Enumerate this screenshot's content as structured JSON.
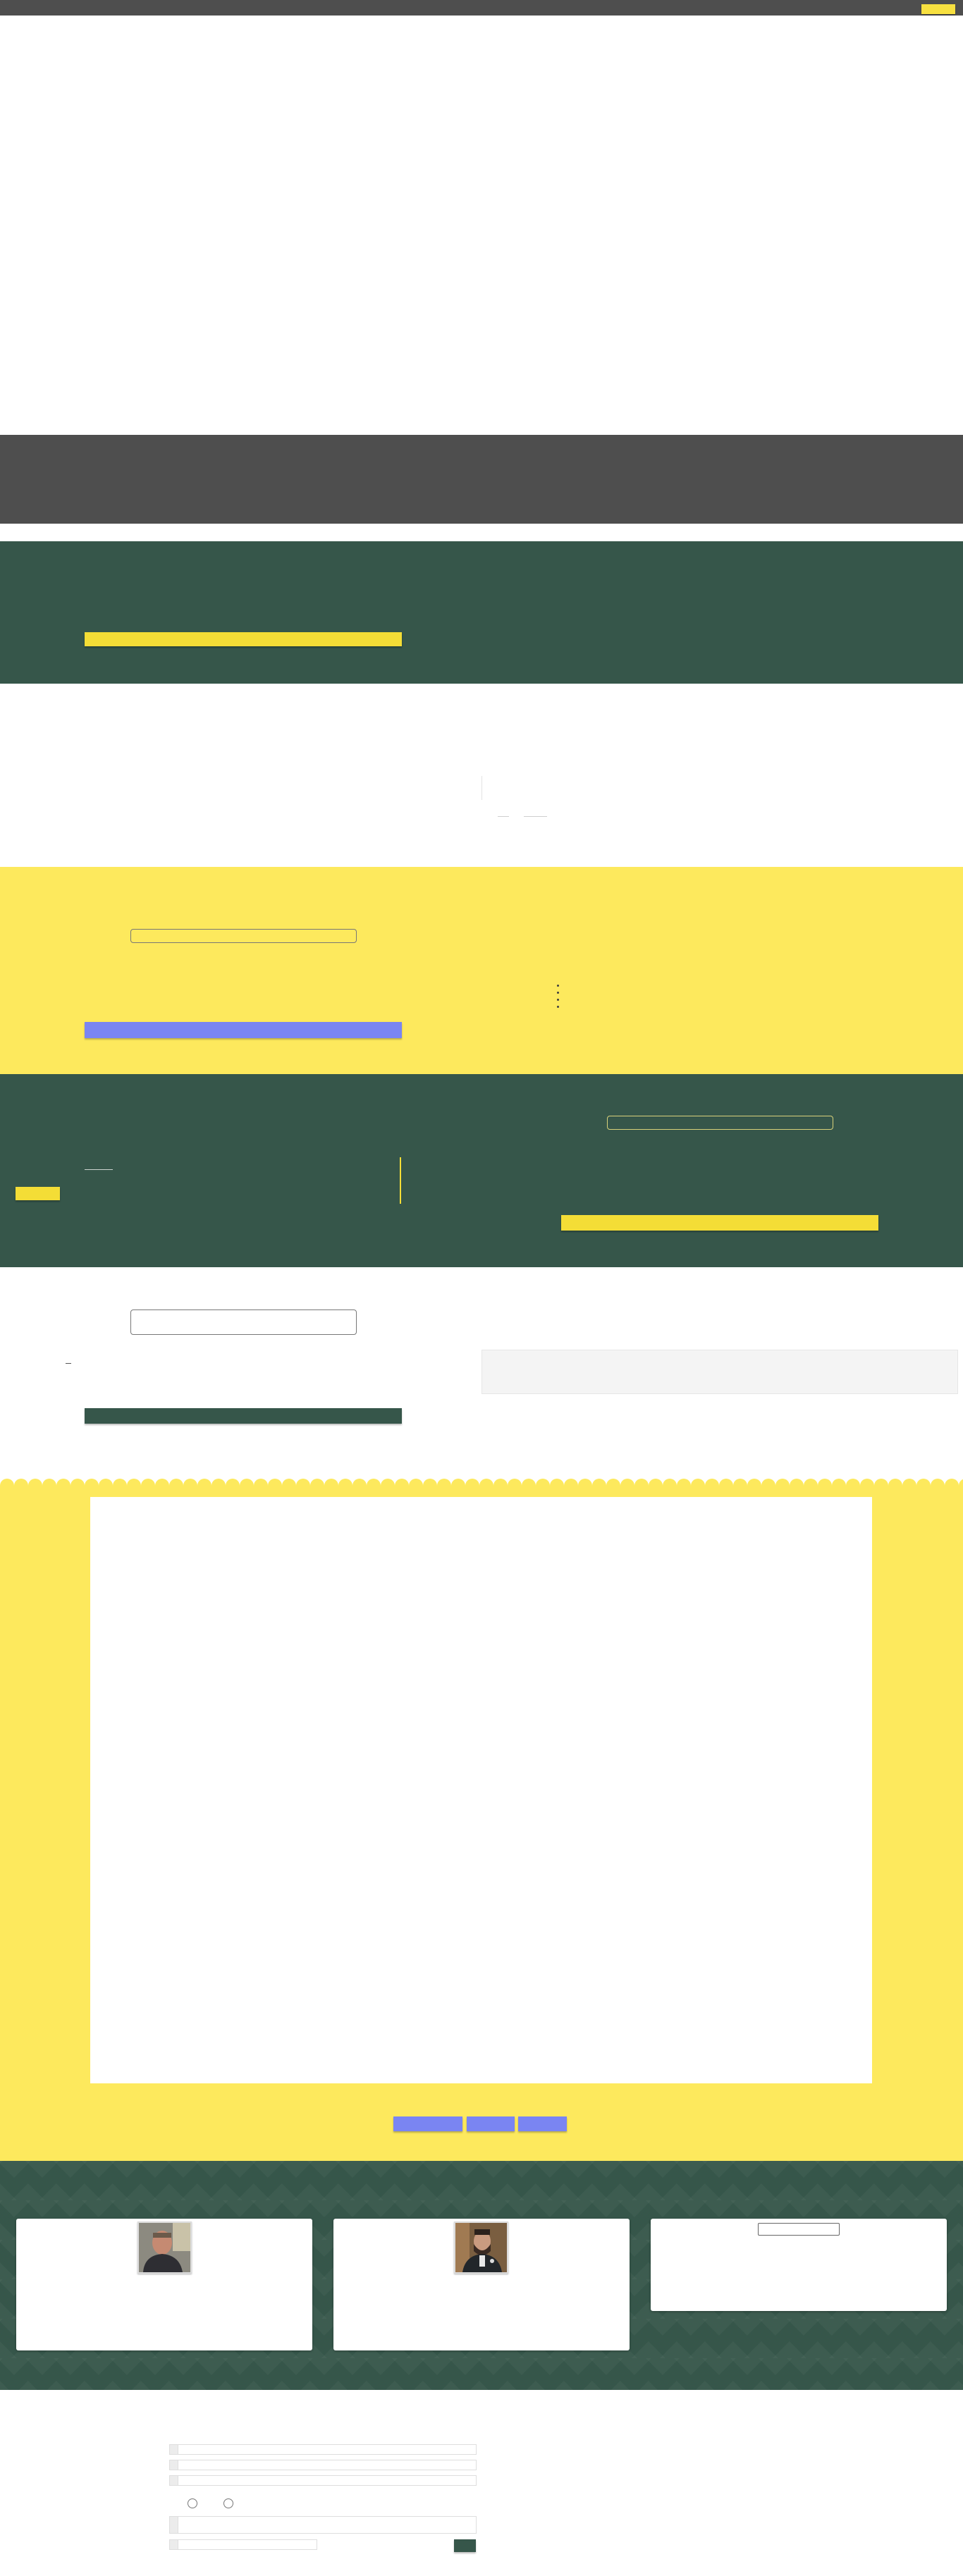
{
  "header": {
    "cta_label": ""
  },
  "sections": {
    "intro_button_label": "",
    "feature_button_label": "",
    "feature_pill_label": "",
    "green_button_label": "",
    "green_pill_label": "",
    "green_small_button_label": "",
    "green_link_text": "",
    "contact_button_label": "",
    "contact_pill_label": "",
    "contact_small_text": ""
  },
  "slider": {
    "tabs": [
      {
        "label": ""
      },
      {
        "label": ""
      },
      {
        "label": ""
      }
    ]
  },
  "testimonials": [
    {
      "name": "",
      "quote": ""
    },
    {
      "name": "",
      "quote": ""
    },
    {
      "name": "",
      "quote": "",
      "button_label": ""
    }
  ],
  "footer_form": {
    "fields": [
      {
        "placeholder": ""
      },
      {
        "placeholder": ""
      },
      {
        "placeholder": ""
      }
    ],
    "radio_options": [
      {
        "label": ""
      },
      {
        "label": ""
      }
    ],
    "message_placeholder": "",
    "short_field_placeholder": "",
    "submit_label": ""
  },
  "colors": {
    "brand_green": "#36564a",
    "brand_yellow": "#fde95d",
    "button_yellow": "#f4dd36",
    "button_blue": "#7a85f2",
    "dark_grey": "#4e4e4e"
  }
}
